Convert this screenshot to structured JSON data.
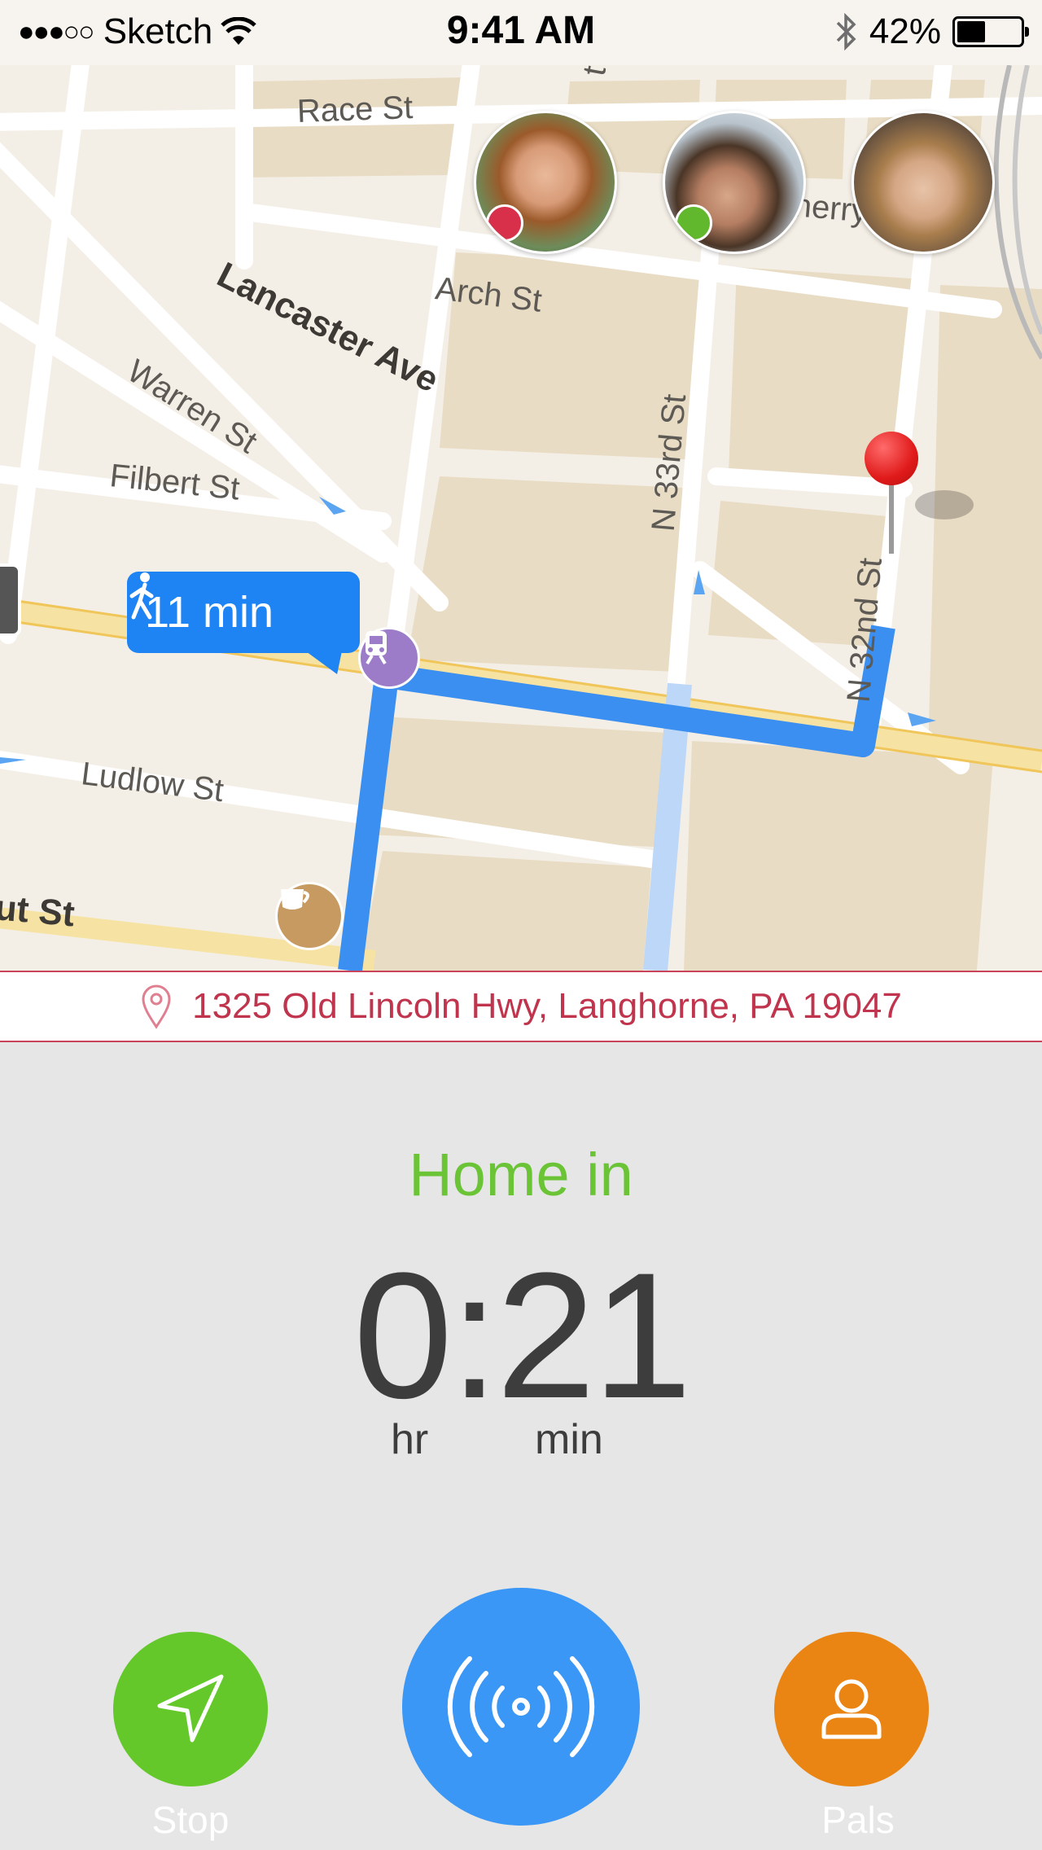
{
  "status": {
    "carrier": "Sketch",
    "signal_dots": "●●●○○",
    "time": "9:41 AM",
    "battery": "42%",
    "battery_level": 0.42
  },
  "map": {
    "streets": {
      "race": "Race St",
      "lancaster": "Lancaster Ave",
      "arch": "Arch St",
      "warren": "Warren St",
      "filbert": "Filbert St",
      "n33rd": "N 33rd St",
      "n32nd": "N 32nd St",
      "ludlow": "Ludlow St",
      "chestnut": "ut St",
      "cherry": "herry",
      "top_cut": "t"
    },
    "walk_time": "11 min",
    "friends": [
      {
        "status_color": "#d8304a"
      },
      {
        "status_color": "#62b82d"
      },
      {
        "status_color": null
      }
    ]
  },
  "address": "1325 Old Lincoln Hwy, Langhorne, PA 19047",
  "eta": {
    "label": "Home in",
    "value": "0:21",
    "hr_label": "hr",
    "min_label": "min"
  },
  "actions": {
    "stop_label": "Stop",
    "pals_label": "Pals"
  },
  "colors": {
    "green": "#64c82a",
    "blue": "#3b97f5",
    "orange": "#ea8514",
    "address_red": "#c0344d"
  }
}
